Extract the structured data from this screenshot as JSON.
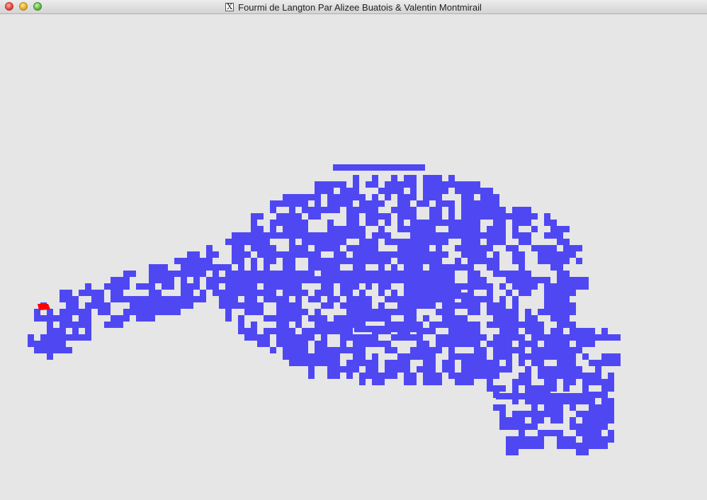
{
  "window": {
    "title": "Fourmi de Langton Par Alizee Buatois & Valentin Montmirail",
    "title_icon": "x11-icon"
  },
  "simulation": {
    "cell_color": "#4f48f2",
    "ant_color": "#ff0000",
    "background_color": "#e6e6e6"
  }
}
